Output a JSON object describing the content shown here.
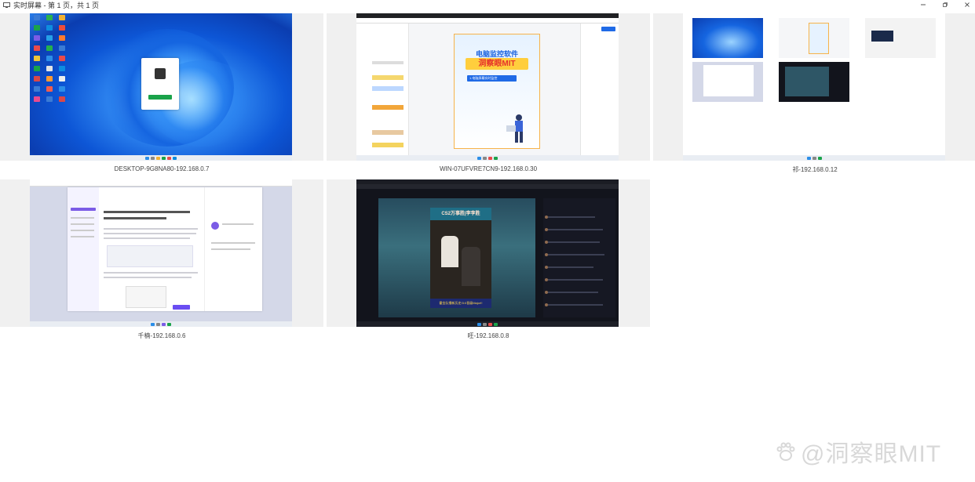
{
  "window": {
    "title": "实时屏幕 - 第 1 页，共 1 页",
    "controls": [
      "minimize",
      "maximize",
      "close"
    ]
  },
  "screens": [
    {
      "label": "DESKTOP-9G8NA80-192.168.0.7"
    },
    {
      "label": "WIN-07UFVRE7CN9-192.168.0.30",
      "poster": {
        "title": "电脑监控软件",
        "brand": "洞察眼MIT",
        "tag": "1.电脑屏幕实时监控"
      }
    },
    {
      "label": "祁-192.168.0.12"
    },
    {
      "label": "千楠-192.168.0.6"
    },
    {
      "label": "旺-192.168.0.8",
      "video": {
        "poster_title": "CS2万事胜|李李胜",
        "poster_footer": "霍金队播新历史!3:0晋级Major!!"
      }
    }
  ],
  "watermark": {
    "text": "@洞察眼MIT"
  },
  "colors": {
    "accent_blue": "#1b63e0",
    "brand_red": "#e6322b",
    "green": "#1aa34a"
  }
}
